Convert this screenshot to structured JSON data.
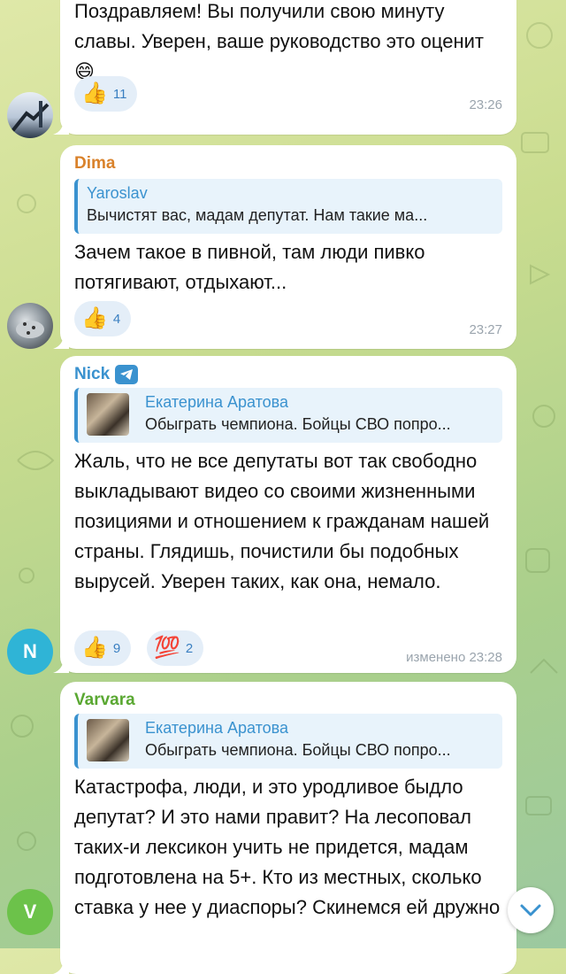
{
  "messages": [
    {
      "text": "Поздравляем! Вы получили свою минуту славы. Уверен, ваше руководство это оценит 😄",
      "reactions": [
        {
          "emoji": "👍",
          "count": "11"
        }
      ],
      "time": "23:26"
    },
    {
      "sender": "Dima",
      "sender_color": "#d9822b",
      "reply": {
        "name": "Yaroslav",
        "text": "Вычистят вас, мадам депутат. Нам такие ма..."
      },
      "text": "Зачем такое в пивной, там люди пивко потягивают, отдыхают...",
      "reactions": [
        {
          "emoji": "👍",
          "count": "4"
        }
      ],
      "time": "23:27"
    },
    {
      "sender": "Nick",
      "sender_color": "#3a92cf",
      "reply": {
        "name": "Екатерина Аратова",
        "text": "Обыграть чемпиона. Бойцы СВО попро..."
      },
      "text": "Жаль, что не все депутаты вот так свободно выкладывают видео со своими жизненными позициями и отношением к гражданам нашей страны. Глядишь, почистили бы подобных вырусей. Уверен таких, как она, немало.",
      "reactions": [
        {
          "emoji": "👍",
          "count": "9"
        },
        {
          "emoji": "💯",
          "count": "2"
        }
      ],
      "time": "изменено 23:28",
      "avatar_letter": "N",
      "avatar_color": "#2fb4d6"
    },
    {
      "sender": "Varvara",
      "sender_color": "#5aa832",
      "reply": {
        "name": "Екатерина Аратова",
        "text": "Обыграть чемпиона. Бойцы СВО попро..."
      },
      "text": "Катастрофа, люди, и это уродливое быдло депутат? И это нами правит? На лесоповал таких-и лексикон учить не придется, мадам подготовлена на 5+. Кто из местных, сколько ставка у нее у диаспоры? Скинемся ей дружно",
      "avatar_letter": "V",
      "avatar_color": "#6cc24a"
    }
  ],
  "icons": {
    "scroll_down": "chevron-down-icon",
    "verified": "telegram-icon"
  }
}
